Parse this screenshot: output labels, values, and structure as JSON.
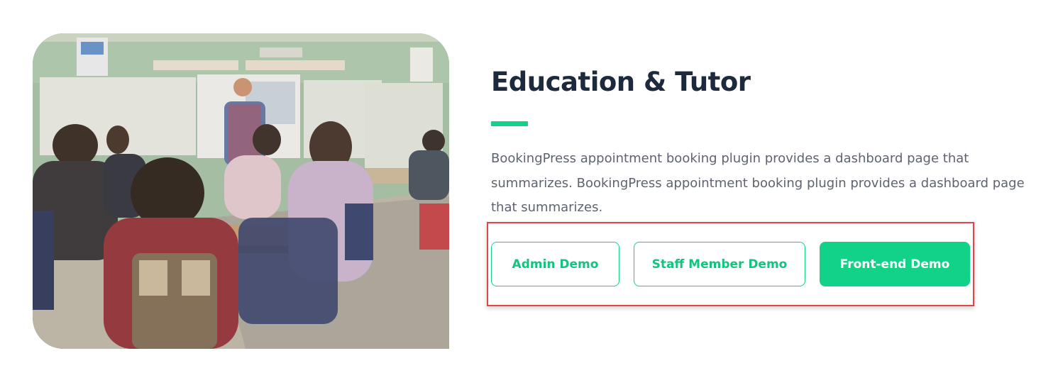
{
  "section": {
    "title": "Education & Tutor",
    "description": "BookingPress appointment booking plugin provides a dashboard page that summarizes. BookingPress appointment booking plugin provides a dashboard page that summarizes.",
    "accent_color": "#12d287",
    "title_color": "#1d2a3e",
    "text_color": "#5e6370"
  },
  "buttons": {
    "admin_demo": "Admin Demo",
    "staff_member_demo": "Staff Member Demo",
    "frontend_demo": "Front-end Demo"
  },
  "highlight": {
    "color": "#e2444a"
  },
  "image": {
    "subject": "classroom-photo"
  }
}
